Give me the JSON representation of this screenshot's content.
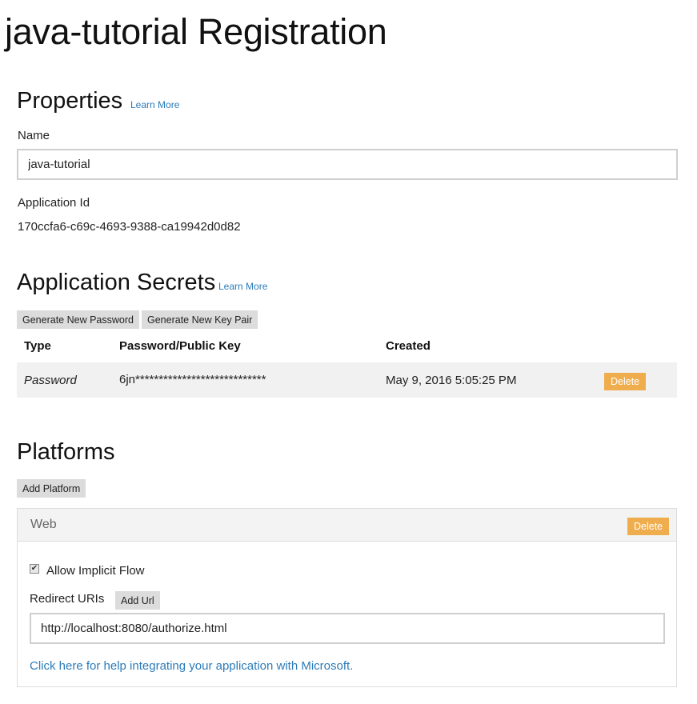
{
  "page": {
    "title": "java-tutorial Registration"
  },
  "properties": {
    "heading": "Properties",
    "learn_more": "Learn More",
    "name_label": "Name",
    "name_value": "java-tutorial",
    "app_id_label": "Application Id",
    "app_id_value": "170ccfa6-c69c-4693-9388-ca19942d0d82"
  },
  "secrets": {
    "heading": "Application Secrets",
    "learn_more": "Learn More",
    "generate_password_label": "Generate New Password",
    "generate_keypair_label": "Generate New Key Pair",
    "columns": [
      "Type",
      "Password/Public Key",
      "Created"
    ],
    "rows": [
      {
        "type": "Password",
        "key": "6jn****************************",
        "created": "May 9, 2016 5:05:25 PM",
        "delete_label": "Delete"
      }
    ]
  },
  "platforms": {
    "heading": "Platforms",
    "add_platform_label": "Add Platform",
    "web": {
      "title": "Web",
      "delete_label": "Delete",
      "allow_implicit_flow_label": "Allow Implicit Flow",
      "allow_implicit_flow_checked": true,
      "redirect_uris_label": "Redirect URIs",
      "add_url_label": "Add Url",
      "redirect_uri_value": "http://localhost:8080/authorize.html",
      "help_link": "Click here for help integrating your application with Microsoft."
    }
  },
  "colors": {
    "accent_link": "#2b7bb9",
    "delete_button": "#f0ad4e",
    "button_gray": "#dcdcdc"
  }
}
